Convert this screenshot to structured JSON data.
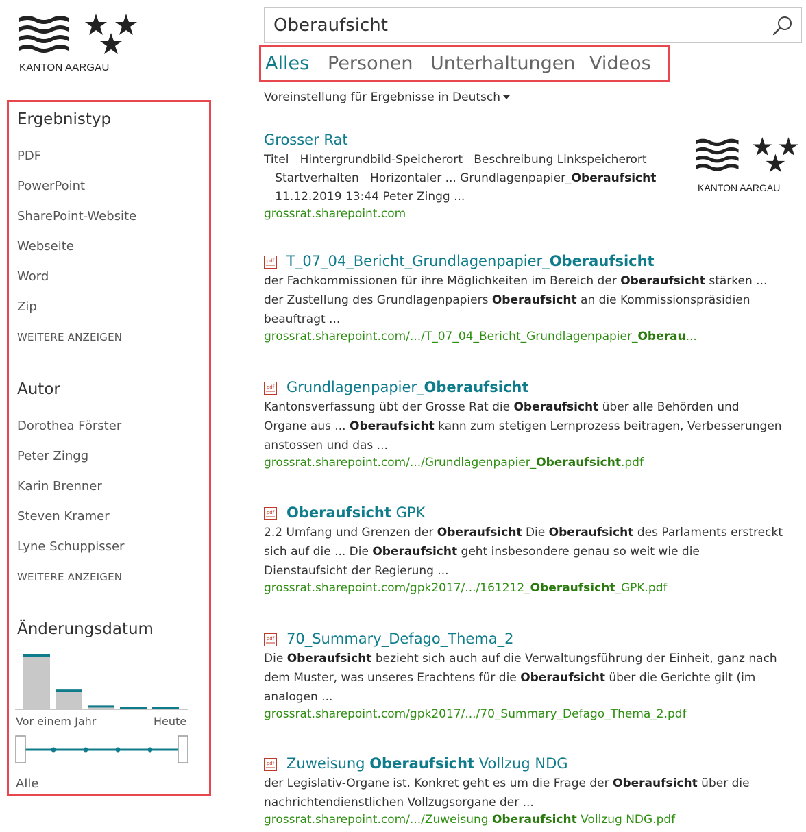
{
  "logo": {
    "text": "KANTON AARGAU"
  },
  "search": {
    "query": "Oberaufsicht",
    "icon": "search-icon"
  },
  "tabs": [
    {
      "label": "Alles",
      "active": true
    },
    {
      "label": "Personen",
      "active": false
    },
    {
      "label": "Unterhaltungen",
      "active": false
    },
    {
      "label": "Videos",
      "active": false
    }
  ],
  "language_preference": "Voreinstellung für Ergebnisse in Deutsch",
  "refiners": {
    "result_type": {
      "title": "Ergebnistyp",
      "items": [
        "PDF",
        "PowerPoint",
        "SharePoint-Website",
        "Webseite",
        "Word",
        "Zip"
      ],
      "more": "WEITERE ANZEIGEN"
    },
    "author": {
      "title": "Autor",
      "items": [
        "Dorothea Förster",
        "Peter Zingg",
        "Karin Brenner",
        "Steven Kramer",
        "Lyne Schuppisser"
      ],
      "more": "WEITERE ANZEIGEN"
    },
    "modified": {
      "title": "Änderungsdatum",
      "label_left": "Vor einem Jahr",
      "label_right": "Heute",
      "value": "Alle",
      "histogram_relative": [
        1.0,
        0.36,
        0.07,
        0.05,
        0.04
      ],
      "bar_color": "#c8c8c8",
      "accent_color": "#0f7c8c"
    }
  },
  "results": [
    {
      "title_pre": "Grosser Rat",
      "title_bold": "",
      "title_post": "",
      "pdf": false,
      "desc_lines": [
        [
          "Titel   Hintergrundbild-Speicherort   Beschreibung Linkspeicherort",
          "",
          ""
        ],
        [
          "   Startverhalten   Horizontaler ... Grundlagenpapier_",
          "Oberaufsicht",
          ""
        ],
        [
          "   11.12.2019 13:44 Peter Zingg ...",
          "",
          ""
        ]
      ],
      "url_pre": "grossrat.sharepoint.com",
      "url_bold": "",
      "url_post": "",
      "thumbnail_text": "KANTON AARGAU"
    },
    {
      "title_pre": "T_07_04_Bericht_Grundlagenpapier_",
      "title_bold": "Oberaufsicht",
      "title_post": "",
      "pdf": true,
      "desc_lines": [
        [
          "der Fachkommissionen für ihre Möglichkeiten im Bereich der ",
          "Oberaufsicht",
          " stärken ..."
        ],
        [
          "der Zustellung des Grundlagenpapiers ",
          "Oberaufsicht",
          " an die Kommissionspräsidien"
        ],
        [
          "beauftragt ...",
          "",
          ""
        ]
      ],
      "url_pre": "grossrat.sharepoint.com/.../T_07_04_Bericht_Grundlagenpapier_",
      "url_bold": "Oberau",
      "url_post": "..."
    },
    {
      "title_pre": "Grundlagenpapier_",
      "title_bold": "Oberaufsicht",
      "title_post": "",
      "pdf": true,
      "desc_lines": [
        [
          "Kantonsverfassung übt der Grosse Rat die ",
          "Oberaufsicht",
          " über alle Behörden und"
        ],
        [
          "Organe aus ... ",
          "Oberaufsicht",
          " kann zum stetigen Lernprozess beitragen, Verbesserungen"
        ],
        [
          "anstossen und das ...",
          "",
          ""
        ]
      ],
      "url_pre": "grossrat.sharepoint.com/.../Grundlagenpapier_",
      "url_bold": "Oberaufsicht",
      "url_post": ".pdf"
    },
    {
      "title_pre": "",
      "title_bold": "Oberaufsicht",
      "title_post": " GPK",
      "pdf": true,
      "desc_lines": [
        [
          "2.2 Umfang und Grenzen der ",
          "Oberaufsicht",
          " Die "
        ],
        [
          "",
          "Oberaufsicht",
          " des Parlaments erstreckt"
        ],
        [
          "sich auf die ... Die ",
          "Oberaufsicht",
          " geht insbesondere genau so weit wie die"
        ],
        [
          "Dienstaufsicht der Regierung ...",
          "",
          ""
        ]
      ],
      "url_pre": "grossrat.sharepoint.com/gpk2017/.../161212_",
      "url_bold": "Oberaufsicht",
      "url_post": "_GPK.pdf"
    },
    {
      "title_pre": "70_Summary_Defago_Thema_2",
      "title_bold": "",
      "title_post": "",
      "pdf": true,
      "desc_lines": [
        [
          "Die ",
          "Oberaufsicht",
          " bezieht sich auch auf die Verwaltungsführung der Einheit, ganz nach"
        ],
        [
          "dem Muster, was unseres Erachtens für die ",
          "Oberaufsicht",
          " über die Gerichte gilt (im"
        ],
        [
          "analogen ...",
          "",
          ""
        ]
      ],
      "url_pre": "grossrat.sharepoint.com/gpk2017/.../70_Summary_Defago_Thema_2.pdf",
      "url_bold": "",
      "url_post": ""
    },
    {
      "title_pre": "Zuweisung ",
      "title_bold": "Oberaufsicht",
      "title_post": " Vollzug NDG",
      "pdf": true,
      "desc_lines": [
        [
          "der Legislativ-Organe ist. Konkret geht es um die Frage der ",
          "Oberaufsicht",
          " über die"
        ],
        [
          "nachrichtendienstlichen Vollzugsorgane der ...",
          "",
          ""
        ]
      ],
      "url_pre": "grossrat.sharepoint.com/.../Zuweisung ",
      "url_bold": "Oberaufsicht",
      "url_post": " Vollzug NDG.pdf"
    }
  ]
}
